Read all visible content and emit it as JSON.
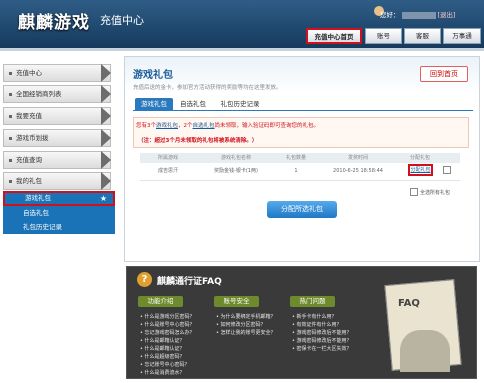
{
  "header": {
    "logo": "麒麟游戏",
    "subtitle": "充值中心",
    "greeting": "您好：",
    "logout": "[退出]",
    "nav": [
      "充值中心首页",
      "账号",
      "客服",
      "万事通"
    ]
  },
  "sidebar": {
    "items": [
      "充值中心",
      "全国经销商列表",
      "我要充值",
      "游戏币划拨",
      "充值查询",
      "我的礼包"
    ],
    "sub_items": [
      "游戏礼包",
      "自选礼包",
      "礼包历史记录"
    ]
  },
  "main": {
    "title": "游戏礼包",
    "desc": "充值后送的金卡，参加官方活动获得的奖励等均在这里发放。",
    "back_home": "回到首页",
    "tabs": [
      "游戏礼包",
      "自选礼包",
      "礼包历史记录"
    ],
    "notice_line1_a": "您有3个",
    "notice_line1_link1": "游戏礼包",
    "notice_line1_b": "，2个",
    "notice_line1_link2": "自选礼包",
    "notice_line1_c": "尚未领取，输入验证码即可查询您的礼包。",
    "notice_line2": "（注：超过3个月未领取的礼包将被系统清除。）",
    "table": {
      "headers": [
        "所属游戏",
        "游戏礼包名称",
        "礼包数量",
        "发奖时间",
        "分配礼包"
      ],
      "row": [
        "成吉思汗",
        "奖励金钱-银卡(1两)",
        "1",
        "2010-6-25 18:58:44",
        "分配礼包"
      ]
    },
    "select_all": "全选所有礼包",
    "alloc_button": "分配所选礼包"
  },
  "faq": {
    "title": "麒麟通行证FAQ",
    "headers": [
      "功能介绍",
      "账号安全",
      "热门问题"
    ],
    "col1": [
      "什么是游戏分区密码？",
      "什么是账号中心密码？",
      "忘记游戏密码怎么办？",
      "什么是邮箱认证？",
      "什么是邮箱认证？",
      "什么是超级密码？",
      "忘记账号中心密码？",
      "什么是消费流水？"
    ],
    "col2": [
      "为什么要绑定手机邮箱？",
      "如何修改分区密码？",
      "怎样让我的账号更安全？"
    ],
    "col3": [
      "新手卡有什么用？",
      "有效证件有什么用？",
      "游戏密码修改后不能用？",
      "游戏密码修改后不能用？",
      "密保卡在一栏大区失效？"
    ],
    "paper_text": "FAQ"
  }
}
